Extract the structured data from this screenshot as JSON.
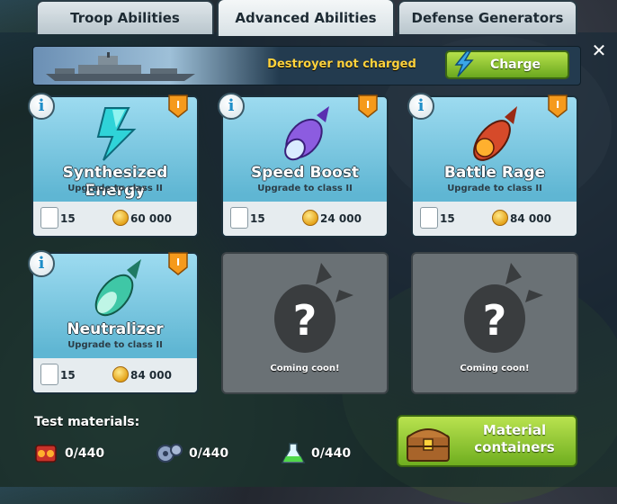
{
  "tabs": [
    {
      "label": "Troop Abilities",
      "active": false
    },
    {
      "label": "Advanced Abilities",
      "active": true
    },
    {
      "label": "Defense Generators",
      "active": false
    }
  ],
  "banner": {
    "status_text": "Destroyer not charged",
    "charge_label": "Charge"
  },
  "close_icon": "close-icon",
  "cards": [
    {
      "title": "Synthesized Energy",
      "subtitle": "Upgrade to class II",
      "material_count": "15",
      "cost": "60 000",
      "level": "I",
      "icon": "lightning-crystal-icon"
    },
    {
      "title": "Speed Boost",
      "subtitle": "Upgrade to class II",
      "material_count": "15",
      "cost": "24 000",
      "level": "I",
      "icon": "purple-rocket-icon"
    },
    {
      "title": "Battle Rage",
      "subtitle": "Upgrade to class II",
      "material_count": "15",
      "cost": "84 000",
      "level": "I",
      "icon": "flaming-missile-icon"
    },
    {
      "title": "Neutralizer",
      "subtitle": "Upgrade to class II",
      "material_count": "15",
      "cost": "84 000",
      "level": "I",
      "icon": "green-torpedo-icon"
    }
  ],
  "locked_cards": [
    {
      "label": "Coming coon!"
    },
    {
      "label": "Coming coon!"
    }
  ],
  "test_materials": {
    "label": "Test materials:",
    "items": [
      {
        "icon": "red-battery-icon",
        "value": "0/440"
      },
      {
        "icon": "gear-cog-icon",
        "value": "0/440"
      },
      {
        "icon": "green-flask-icon",
        "value": "0/440"
      }
    ]
  },
  "material_containers": {
    "label_line1": "Material",
    "label_line2": "containers"
  },
  "colors": {
    "accent_green": "#8cc63f",
    "banner_text": "#ffd23c",
    "card_blue": "#7cc9e3"
  }
}
